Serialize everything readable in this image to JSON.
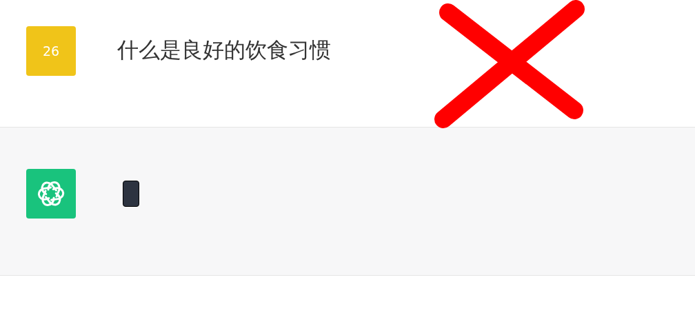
{
  "messages": [
    {
      "kind": "user",
      "avatar": "26",
      "color": "#f0c419",
      "text": "什么是良好的饮食习惯"
    },
    {
      "kind": "assistant",
      "text_cursor": true
    }
  ],
  "cross_mark": true
}
